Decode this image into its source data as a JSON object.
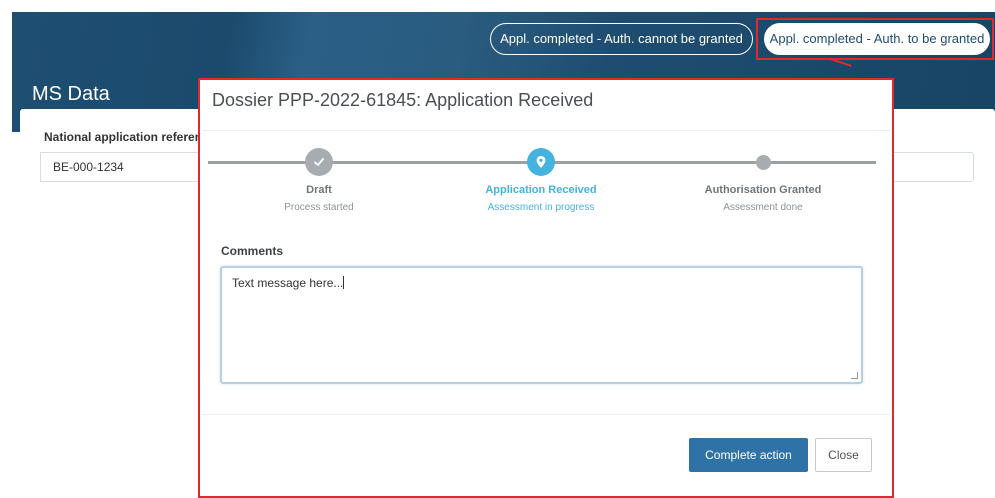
{
  "header": {
    "title": "MS Data",
    "status_buttons": [
      {
        "label": "Appl. completed - Auth. cannot be granted"
      },
      {
        "label": "Appl. completed - Auth. to be granted"
      }
    ]
  },
  "background_form": {
    "national_reference_label": "National application referen",
    "national_reference_value": "BE-000-1234"
  },
  "modal": {
    "title": "Dossier PPP-2022-61845: Application Received",
    "steps": [
      {
        "title": "Draft",
        "subtitle": "Process started",
        "state": "done",
        "icon": "check-icon"
      },
      {
        "title": "Application Received",
        "subtitle": "Assessment in progress",
        "state": "active",
        "icon": "location-pin-icon"
      },
      {
        "title": "Authorisation Granted",
        "subtitle": "Assessment done",
        "state": "pending",
        "icon": "dot-icon"
      }
    ],
    "comments_label": "Comments",
    "comments_value": "Text message here...",
    "complete_button": "Complete action",
    "close_button": "Close"
  },
  "colors": {
    "header_bg": "#1e4e72",
    "highlight_red": "#e0282e",
    "active_step": "#46b3de",
    "primary_button": "#2f73a6",
    "inactive_step": "#a7acb1"
  }
}
